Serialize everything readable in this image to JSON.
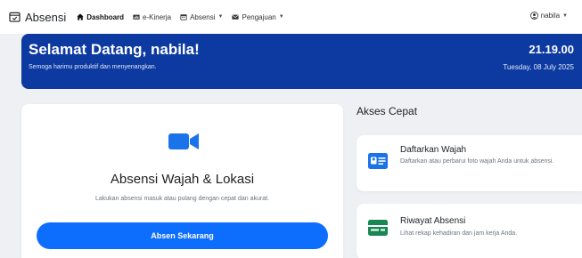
{
  "navbar": {
    "brand": "Absensi",
    "items": [
      {
        "label": "Dashboard",
        "active": true
      },
      {
        "label": "e-Kinerja",
        "dropdown": false
      },
      {
        "label": "Absensi",
        "dropdown": true
      },
      {
        "label": "Pengajuan",
        "dropdown": true
      }
    ],
    "user": "nabila"
  },
  "banner": {
    "title": "Selamat Datang, nabila!",
    "subtitle": "Semoga harimu produktif dan menyenangkan.",
    "time": "21.19.00",
    "date": "Tuesday, 08 July 2025"
  },
  "main_card": {
    "title": "Absensi Wajah & Lokasi",
    "description": "Lakukan absensi masuk atau pulang dengan cepat dan akurat.",
    "button": "Absen Sekarang"
  },
  "quick_access": {
    "title": "Akses Cepat",
    "items": [
      {
        "title": "Daftarkan Wajah",
        "description": "Daftarkan atau perbarui foto wajah Anda untuk absensi.",
        "icon": "id-card-icon"
      },
      {
        "title": "Riwayat Absensi",
        "description": "Lihat rekap kehadiran dan jam kerja Anda.",
        "icon": "history-icon"
      }
    ]
  },
  "colors": {
    "banner": "#0d3aa0",
    "primary": "#0d6efd",
    "icon_blue": "#1a73e8",
    "icon_green": "#198754"
  }
}
